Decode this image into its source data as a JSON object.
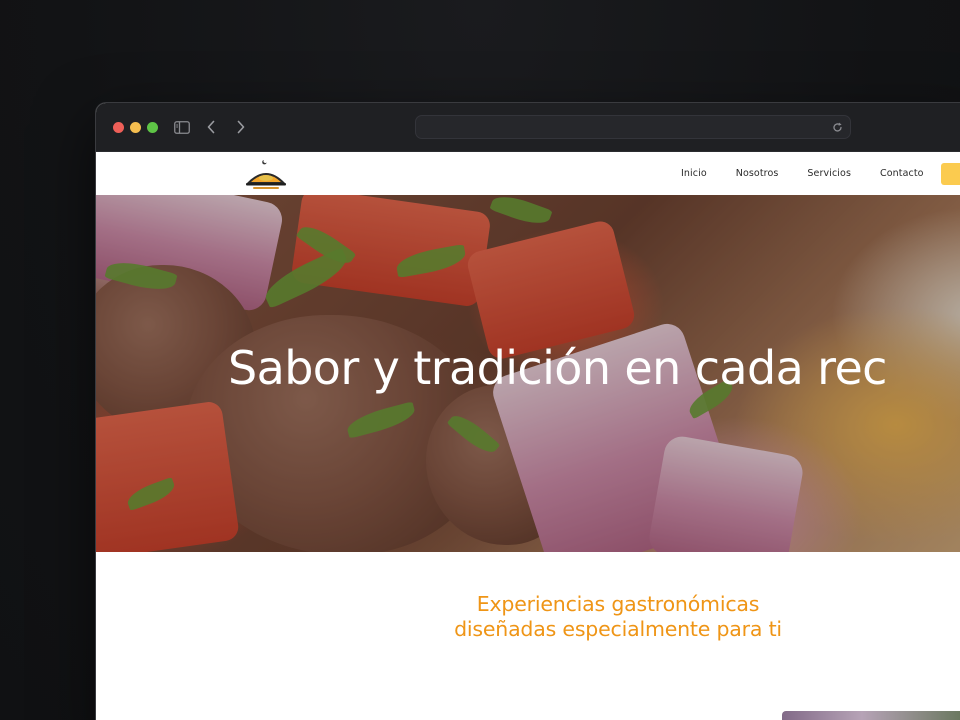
{
  "site": {
    "nav": {
      "links": [
        "Inicio",
        "Nosotros",
        "Servicios",
        "Contacto"
      ]
    },
    "hero": {
      "title": "Sabor y tradición en cada rec"
    },
    "tagline": {
      "line1": "Experiencias gastronómicas",
      "line2": "diseñadas especialmente para ti"
    }
  },
  "colors": {
    "desktop_background": "#121315",
    "browser_chrome": "#1f2023",
    "traffic_red": "#ee5f58",
    "traffic_yellow": "#f4bd4f",
    "traffic_green": "#5ec446",
    "accent_orange": "#ef9516",
    "cta_yellow": "#fbcb4f"
  },
  "icons": {
    "sidebar": "sidebar-icon",
    "back": "chevron-left-icon",
    "forward": "chevron-right-icon",
    "reload": "reload-icon",
    "logo": "restaurant-logo"
  }
}
